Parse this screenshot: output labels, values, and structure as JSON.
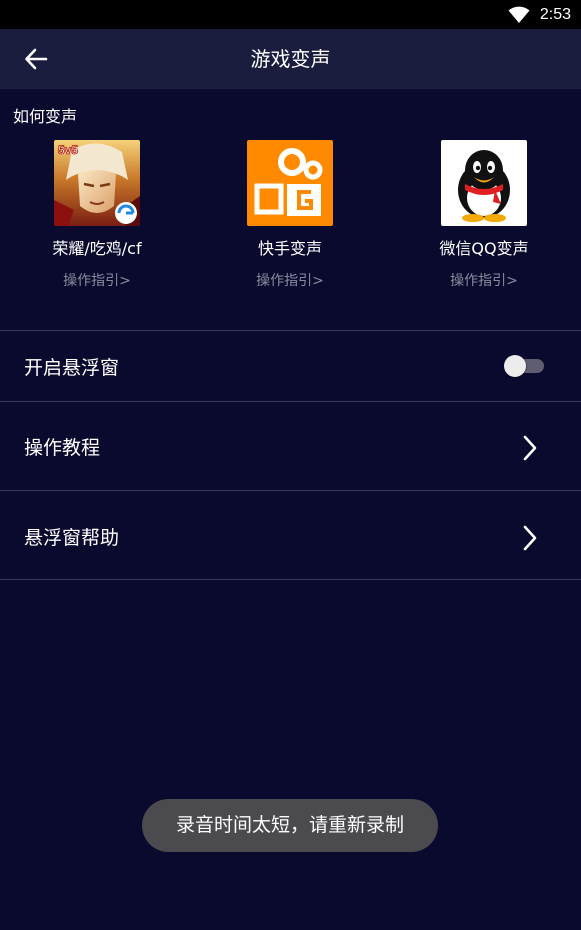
{
  "status_bar": {
    "time": "2:53",
    "wifi_icon": "wifi-icon"
  },
  "app_bar": {
    "title": "游戏变声",
    "back_icon": "arrow-left-icon"
  },
  "section": {
    "label": "如何变声"
  },
  "apps": [
    {
      "name": "荣耀/吃鸡/cf",
      "guide": "操作指引>",
      "icon": "honor-of-kings-icon"
    },
    {
      "name": "快手变声",
      "guide": "操作指引>",
      "icon": "kuaishou-icon"
    },
    {
      "name": "微信QQ变声",
      "guide": "操作指引>",
      "icon": "qq-penguin-icon"
    }
  ],
  "settings": [
    {
      "label": "开启悬浮窗",
      "control": "toggle",
      "enabled": false
    },
    {
      "label": "操作教程",
      "control": "chevron"
    },
    {
      "label": "悬浮窗帮助",
      "control": "chevron"
    }
  ],
  "toast": {
    "text": "录音时间太短，请重新录制"
  },
  "colors": {
    "background": "#0a0a2e",
    "app_bar": "#1b1d3e",
    "divider": "#3a3b5a",
    "guide_text": "#8a8a9e",
    "toast_bg": "#4a4a4f",
    "kuaishou_orange": "#ff8a00"
  }
}
